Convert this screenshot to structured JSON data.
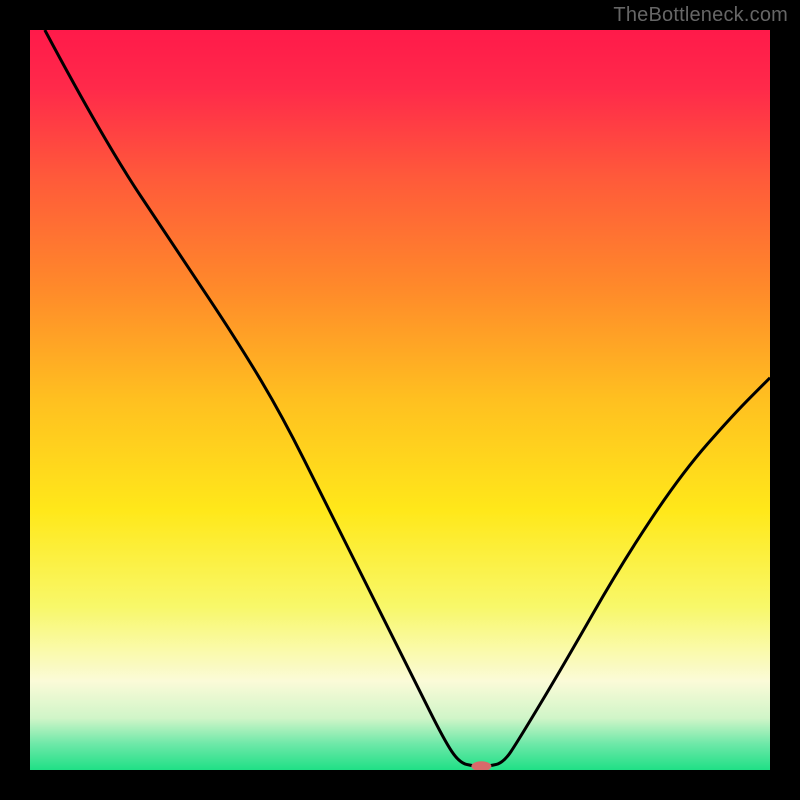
{
  "watermark": "TheBottleneck.com",
  "chart_data": {
    "type": "line",
    "title": "",
    "xlabel": "",
    "ylabel": "",
    "xlim": [
      0,
      100
    ],
    "ylim": [
      0,
      100
    ],
    "background_gradient": {
      "stops": [
        {
          "offset": 0.0,
          "color": "#ff1a4a"
        },
        {
          "offset": 0.08,
          "color": "#ff2a4a"
        },
        {
          "offset": 0.2,
          "color": "#ff5a3a"
        },
        {
          "offset": 0.35,
          "color": "#ff8a2a"
        },
        {
          "offset": 0.5,
          "color": "#ffc020"
        },
        {
          "offset": 0.65,
          "color": "#ffe81a"
        },
        {
          "offset": 0.78,
          "color": "#f8f86a"
        },
        {
          "offset": 0.88,
          "color": "#fbfbd8"
        },
        {
          "offset": 0.93,
          "color": "#d0f5c8"
        },
        {
          "offset": 0.965,
          "color": "#6de8a8"
        },
        {
          "offset": 1.0,
          "color": "#1fe086"
        }
      ]
    },
    "series": [
      {
        "name": "bottleneck-curve",
        "color": "#000000",
        "points": [
          {
            "x": 2,
            "y": 100
          },
          {
            "x": 10,
            "y": 85
          },
          {
            "x": 20,
            "y": 70
          },
          {
            "x": 28,
            "y": 58
          },
          {
            "x": 34,
            "y": 48
          },
          {
            "x": 40,
            "y": 36
          },
          {
            "x": 46,
            "y": 24
          },
          {
            "x": 52,
            "y": 12
          },
          {
            "x": 56,
            "y": 4
          },
          {
            "x": 58,
            "y": 1
          },
          {
            "x": 60,
            "y": 0.5
          },
          {
            "x": 62,
            "y": 0.5
          },
          {
            "x": 64,
            "y": 1
          },
          {
            "x": 66,
            "y": 4
          },
          {
            "x": 72,
            "y": 14
          },
          {
            "x": 80,
            "y": 28
          },
          {
            "x": 88,
            "y": 40
          },
          {
            "x": 95,
            "y": 48
          },
          {
            "x": 100,
            "y": 53
          }
        ]
      }
    ],
    "marker": {
      "name": "optimal-point",
      "x": 61,
      "y": 0.5,
      "color": "#d96a6a",
      "rx": 10,
      "ry": 5
    }
  }
}
